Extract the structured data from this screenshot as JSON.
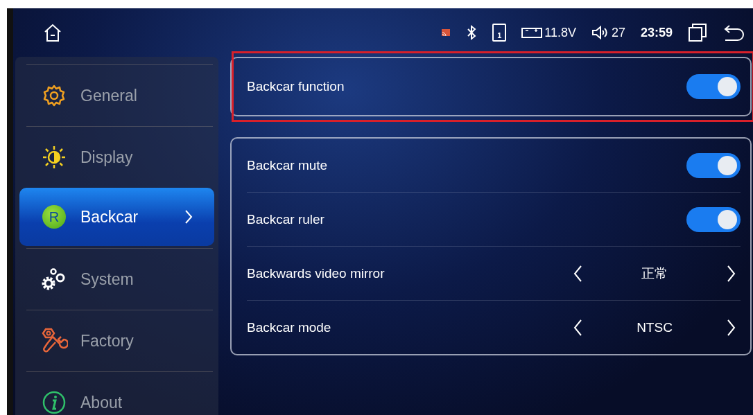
{
  "status_bar": {
    "usb_label": "1",
    "voltage": "11.8V",
    "volume": "27",
    "time": "23:59"
  },
  "sidebar": {
    "items": [
      {
        "label": "General",
        "selected": false
      },
      {
        "label": "Display",
        "selected": false
      },
      {
        "label": "Backcar",
        "selected": true,
        "badge": "R"
      },
      {
        "label": "System",
        "selected": false
      },
      {
        "label": "Factory",
        "selected": false
      },
      {
        "label": "About",
        "selected": false
      }
    ]
  },
  "groups": [
    {
      "highlighted": true,
      "rows": [
        {
          "kind": "toggle",
          "label": "Backcar function",
          "on": true
        }
      ]
    },
    {
      "highlighted": false,
      "rows": [
        {
          "kind": "toggle",
          "label": "Backcar mute",
          "on": true
        },
        {
          "kind": "toggle",
          "label": "Backcar ruler",
          "on": true
        },
        {
          "kind": "selector",
          "label": "Backwards video mirror",
          "value": "正常"
        },
        {
          "kind": "selector",
          "label": "Backcar mode",
          "value": "NTSC"
        }
      ]
    }
  ]
}
